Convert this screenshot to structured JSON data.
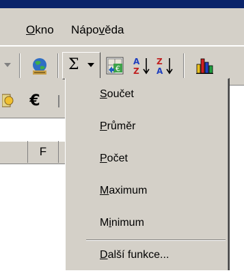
{
  "menubar": {
    "items": [
      {
        "label": "Okno",
        "mnemonic": "O",
        "rest": "kno"
      },
      {
        "label": "Nápověda",
        "pre": "Nápo",
        "mnemonic": "v",
        "rest": "ěda"
      }
    ]
  },
  "toolbar": {
    "sum_symbol": "Σ",
    "sort_asc_top": "A",
    "sort_asc_bottom": "Z",
    "sort_desc_top": "Z",
    "sort_desc_bottom": "A",
    "euro_symbol": "€"
  },
  "grid": {
    "column_label": "F"
  },
  "autosum_menu": {
    "items": [
      {
        "mnemonic": "S",
        "rest": "oučet",
        "full": "Součet"
      },
      {
        "mnemonic": "P",
        "rest": "růměr",
        "full": "Průměr"
      },
      {
        "mnemonic": "P",
        "rest": "očet",
        "full": "Počet"
      },
      {
        "mnemonic": "M",
        "rest": "aximum",
        "full": "Maximum"
      },
      {
        "pre": "M",
        "mnemonic": "i",
        "rest": "nimum",
        "full": "Minimum"
      },
      {
        "mnemonic": "D",
        "rest": "alší funkce...",
        "full": "Další funkce..."
      }
    ]
  },
  "colors": {
    "chrome": "#d4d0c8",
    "title_bar": "#0a246a",
    "shadow": "#808080",
    "highlight": "#ffffff"
  }
}
